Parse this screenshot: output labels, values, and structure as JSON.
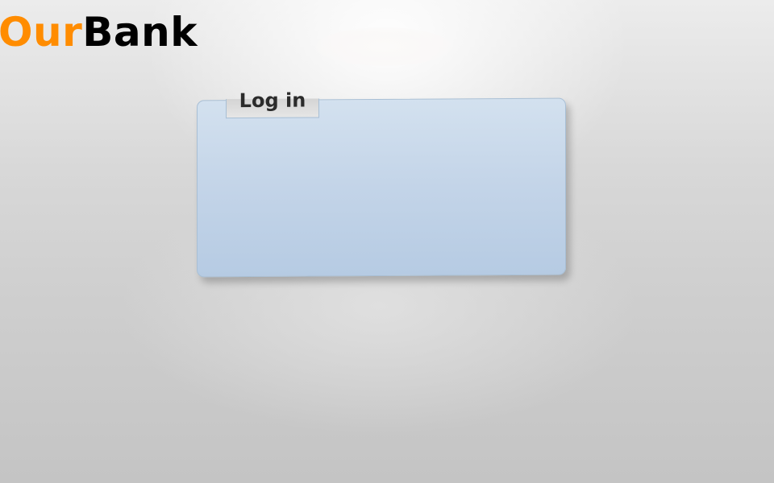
{
  "brand": {
    "part1": "Our",
    "part2": "Bank"
  },
  "login_panel": {
    "title": "Log in"
  },
  "colors": {
    "brand_orange": "#ff8c00",
    "brand_black": "#000000",
    "panel_blue": "#c3d4e8",
    "panel_border": "#a8bfd5",
    "tab_grey": "#e0e0e0",
    "background": "#d0d0d0"
  }
}
